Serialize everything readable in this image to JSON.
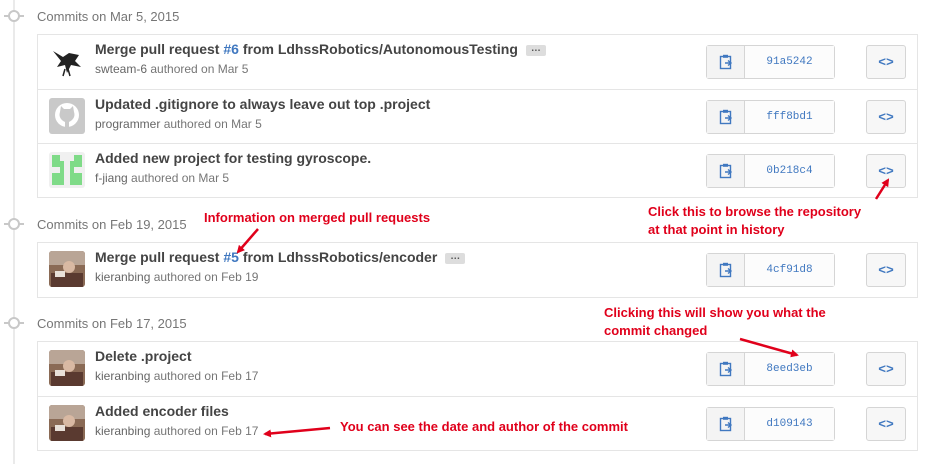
{
  "groups": [
    {
      "title": "Commits on Mar 5, 2015",
      "commits": [
        {
          "msg_before": "Merge pull request ",
          "pr": "#6",
          "msg_after": " from LdhssRobotics/AutonomousTesting",
          "ellipsis": "…",
          "author": "swteam-6",
          "meta": " authored on Mar 5",
          "sha": "91a5242",
          "avatar": "crow"
        },
        {
          "msg_before": "Updated .gitignore to always leave out top .project",
          "pr": "",
          "msg_after": "",
          "ellipsis": "",
          "author": "programmer",
          "meta": " authored on Mar 5",
          "sha": "fff8bd1",
          "avatar": "github"
        },
        {
          "msg_before": "Added new project for testing gyroscope.",
          "pr": "",
          "msg_after": "",
          "ellipsis": "",
          "author": "f-jiang",
          "meta": " authored on Mar 5",
          "sha": "0b218c4",
          "avatar": "identicon"
        }
      ]
    },
    {
      "title": "Commits on Feb 19, 2015",
      "commits": [
        {
          "msg_before": "Merge pull request ",
          "pr": "#5",
          "msg_after": " from LdhssRobotics/encoder",
          "ellipsis": "…",
          "author": "kieranbing",
          "meta": " authored on Feb 19",
          "sha": "4cf91d8",
          "avatar": "photo"
        }
      ]
    },
    {
      "title": "Commits on Feb 17, 2015",
      "commits": [
        {
          "msg_before": "Delete .project",
          "pr": "",
          "msg_after": "",
          "ellipsis": "",
          "author": "kieranbing",
          "meta": " authored on Feb 17",
          "sha": "8eed3eb",
          "avatar": "photo"
        },
        {
          "msg_before": "Added encoder files",
          "pr": "",
          "msg_after": "",
          "ellipsis": "",
          "author": "kieranbing",
          "meta": " authored on Feb 17",
          "sha": "d109143",
          "avatar": "photo"
        }
      ]
    }
  ],
  "browse_label": "<>",
  "annotations": {
    "merged_pr": "Information on merged pull requests",
    "browse_line1": "Click this to browse the repository",
    "browse_line2": "at that point in history",
    "sha_line1": "Clicking this will show you what the",
    "sha_line2": "commit changed",
    "date_author": "You can see the date and author of the commit"
  },
  "colors": {
    "link": "#4078c0",
    "annotation": "#e0001b",
    "muted": "#767676"
  },
  "icons": {
    "copy": "clipboard-icon",
    "browse": "code-icon",
    "timeline": "commit-node-icon"
  }
}
